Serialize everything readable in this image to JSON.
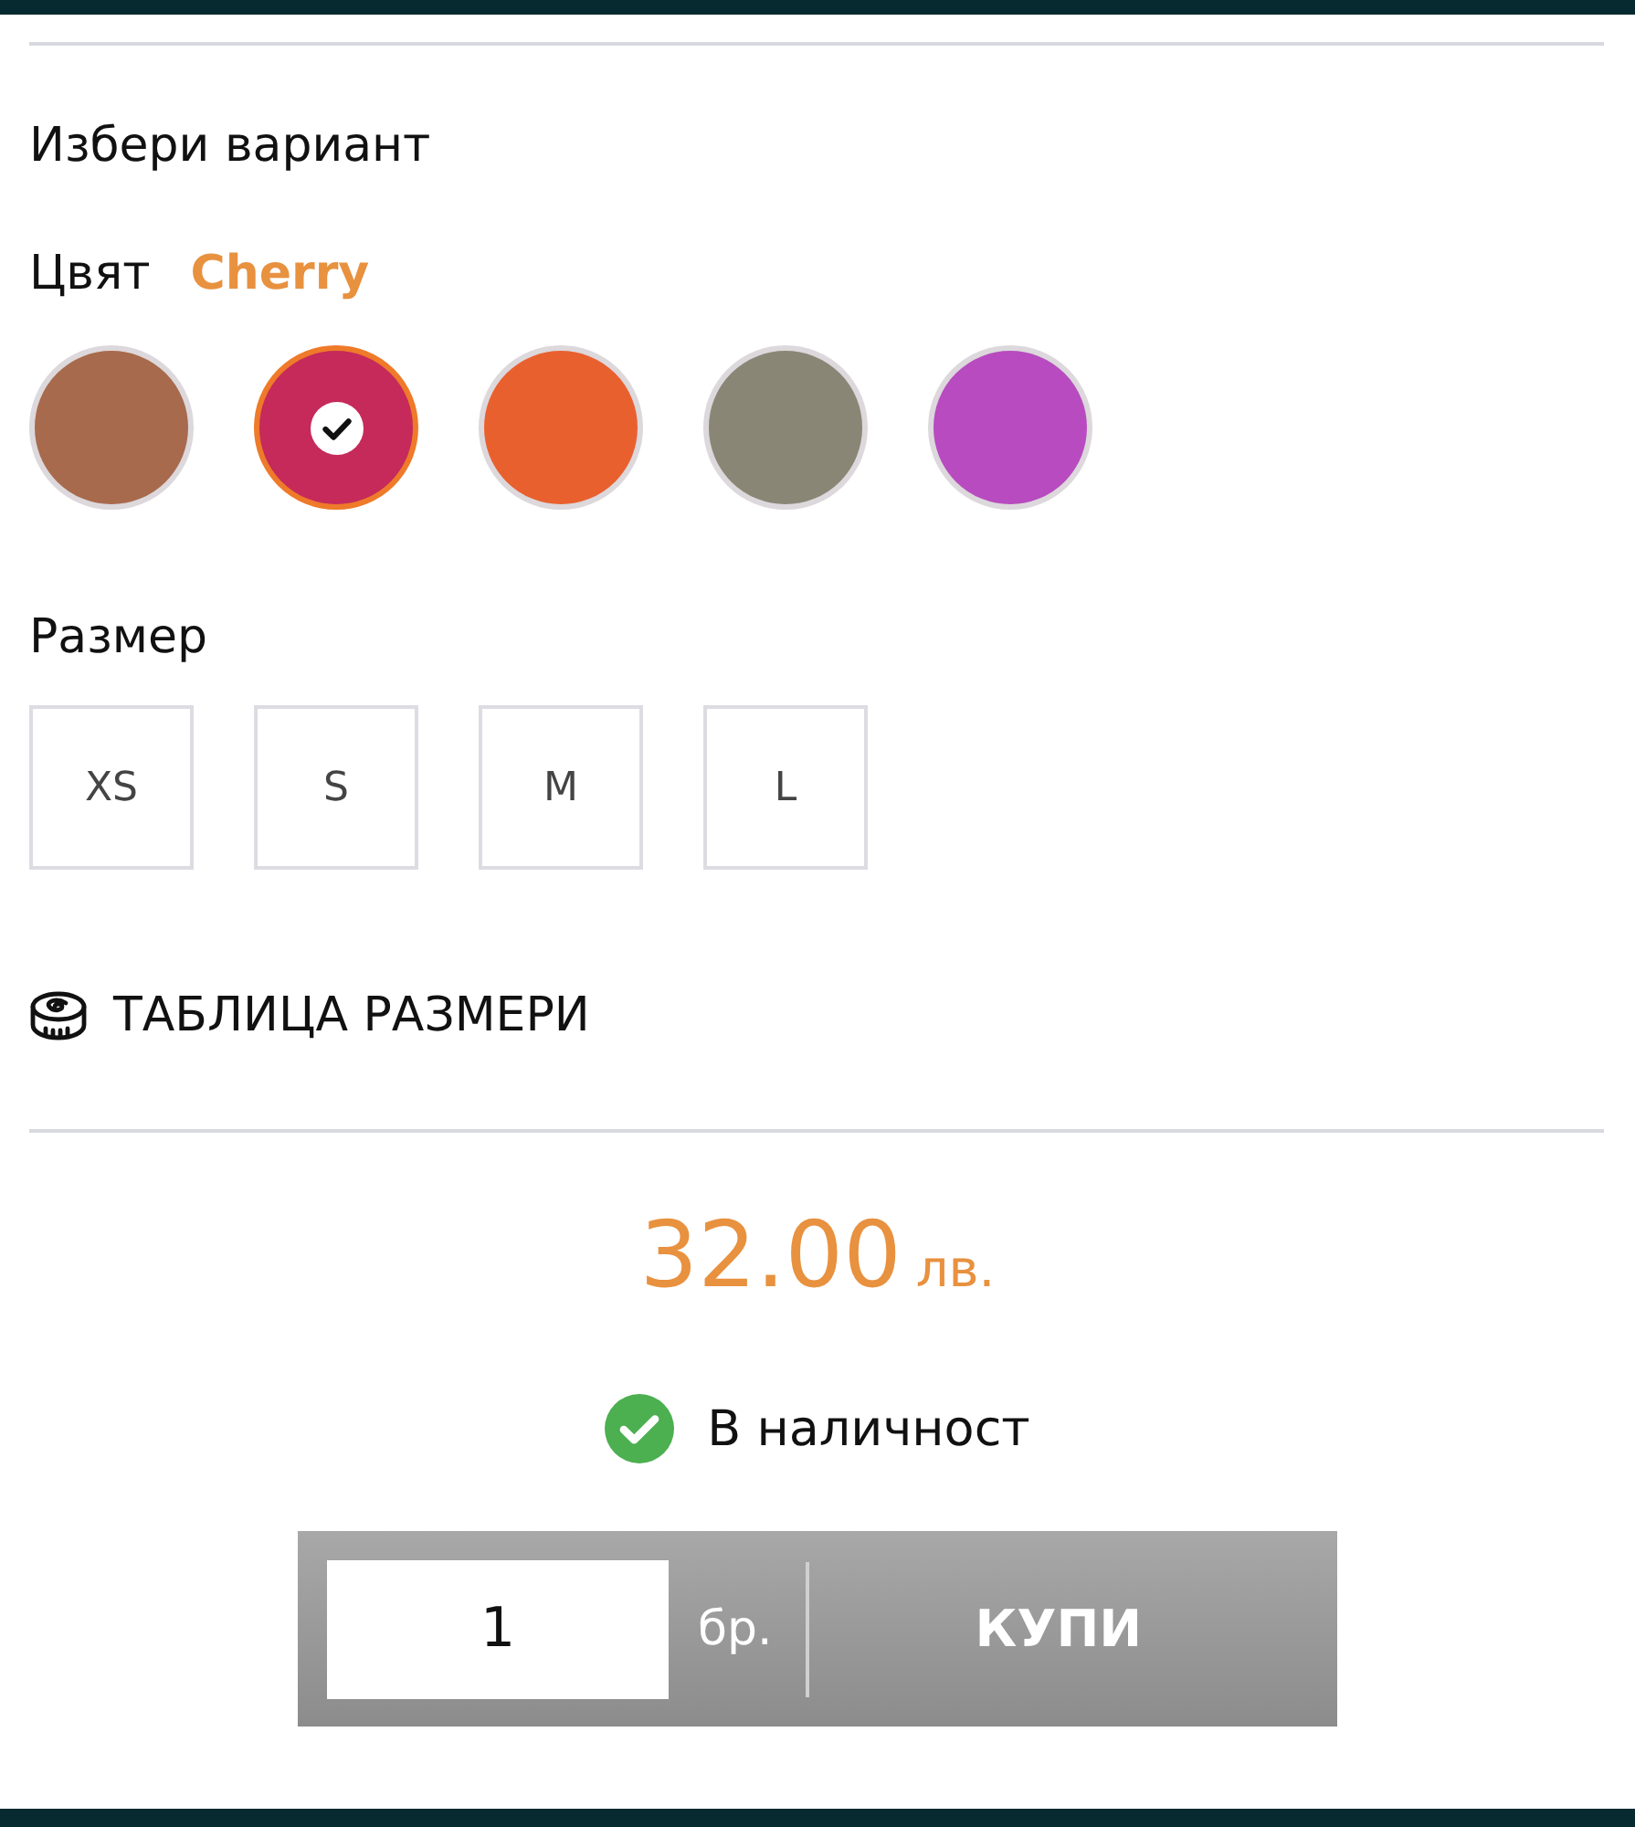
{
  "heading": "Избери вариант",
  "color_picker": {
    "label": "Цвят",
    "selected_name": "Cherry",
    "swatches": [
      {
        "color": "#a86a4c",
        "selected": false
      },
      {
        "color": "#c52a5a",
        "selected": true
      },
      {
        "color": "#e9602f",
        "selected": false
      },
      {
        "color": "#8a8676",
        "selected": false
      },
      {
        "color": "#b84bbf",
        "selected": false
      }
    ]
  },
  "size_picker": {
    "label": "Размер",
    "sizes": [
      {
        "label": "XS",
        "selected": false
      },
      {
        "label": "S",
        "selected": false
      },
      {
        "label": "M",
        "selected": false
      },
      {
        "label": "L",
        "selected": false
      }
    ]
  },
  "size_chart_link": "ТАБЛИЦА РАЗМЕРИ",
  "price": {
    "amount": "32.00",
    "currency": "лв."
  },
  "stock": {
    "text": "В наличност",
    "in_stock": true
  },
  "quantity": {
    "value": "1",
    "unit": "бр."
  },
  "buy_button": "КУПИ"
}
